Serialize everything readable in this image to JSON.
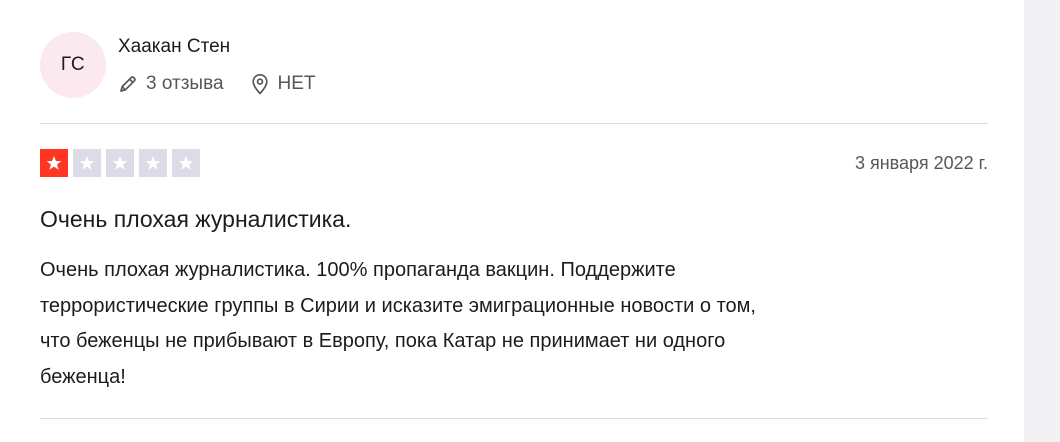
{
  "reviewer": {
    "initials": "ГС",
    "name": "Хаакан Стен",
    "reviews_count": "3 отзыва",
    "country": "НЕТ",
    "icons": {
      "reviews": "pencil-icon",
      "country": "location-pin-icon"
    }
  },
  "review": {
    "rating": 1,
    "rating_max": 5,
    "date": "3 января 2022 г.",
    "title": "Очень плохая журналистика.",
    "body_lines": [
      "Очень плохая журналистика. 100% пропаганда вакцин. Поддержите",
      "террористические группы в Сирии и исказите эмиграционные новости о том,",
      "что беженцы не прибывают в Европу, пока Катар не принимает ни одного",
      "беженца!"
    ]
  },
  "colors": {
    "star_active": "#ff3722",
    "star_inactive": "#dcdce6",
    "avatar_bg": "#fce8ef",
    "muted_text": "#575757",
    "divider": "#dcdce2"
  }
}
